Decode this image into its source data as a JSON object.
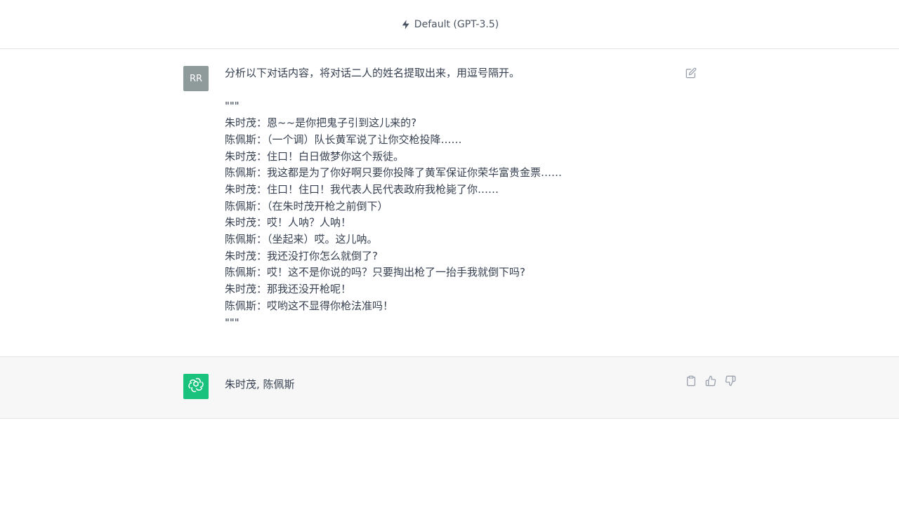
{
  "header": {
    "model_label": "Default (GPT-3.5)",
    "model_icon": "bolt-icon"
  },
  "user_message": {
    "avatar_initials": "RR",
    "prompt": "分析以下对话内容，将对话二人的姓名提取出来，用逗号隔开。",
    "lines": [
      "\"\"\"",
      "朱时茂：恩~~是你把鬼子引到这儿来的?",
      "陈佩斯：（一个调）队长黄军说了让你交枪投降……",
      "朱时茂：住口！白日做梦你这个叛徒。",
      "陈佩斯：我这都是为了你好啊只要你投降了黄军保证你荣华富贵金票……",
      "朱时茂：住口！住口！我代表人民代表政府我枪毙了你……",
      "陈佩斯：（在朱时茂开枪之前倒下）",
      "朱时茂：哎！人呐？人呐！",
      "陈佩斯：（坐起来）哎。这儿呐。",
      "朱时茂：我还没打你怎么就倒了?",
      "陈佩斯：哎！这不是你说的吗？只要掏出枪了一抬手我就倒下吗?",
      "朱时茂：那我还没开枪呢！",
      "陈佩斯：哎哟这不显得你枪法准吗！",
      "\"\"\""
    ],
    "edit_icon": "edit-icon"
  },
  "assistant_message": {
    "avatar_icon": "openai-logo-icon",
    "text": "朱时茂, 陈佩斯",
    "actions": [
      "clipboard-icon",
      "thumbs-up-icon",
      "thumbs-down-icon"
    ]
  },
  "colors": {
    "user_avatar_bg": "#8f9b9a",
    "bot_avatar_bg": "#19c37d",
    "assistant_row_bg": "#f7f7f8",
    "text": "#374151",
    "icon": "#9ca3af"
  }
}
